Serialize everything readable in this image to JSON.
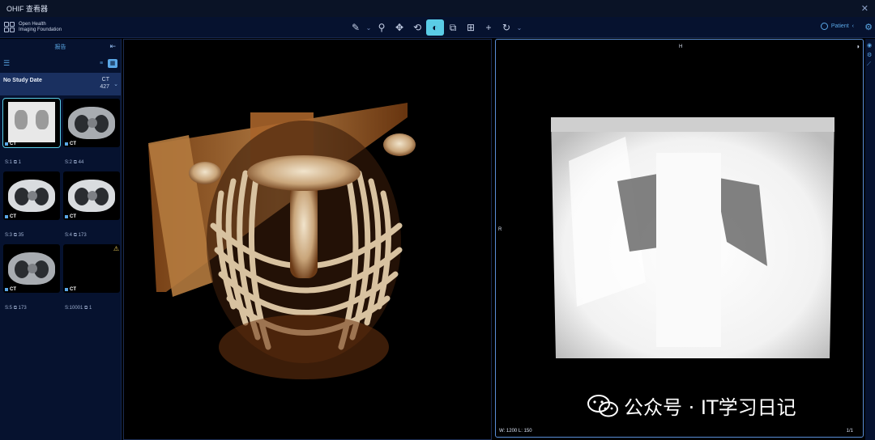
{
  "window": {
    "title": "OHIF 查看器",
    "close_icon": "close-icon"
  },
  "header": {
    "logo_line1": "Open Health",
    "logo_line2": "Imaging Foundation",
    "patient_label": "Patient",
    "tools": [
      {
        "name": "measure-icon",
        "glyph": "✎"
      },
      {
        "name": "measure-dropdown-icon",
        "glyph": "⌄",
        "small": true
      },
      {
        "name": "zoom-icon",
        "glyph": "⚲"
      },
      {
        "name": "pan-icon",
        "glyph": "✥"
      },
      {
        "name": "rotate-3d-icon",
        "glyph": "⟲"
      },
      {
        "name": "window-level-icon",
        "glyph": "◐",
        "active": true
      },
      {
        "name": "camera-icon",
        "glyph": "⧉"
      },
      {
        "name": "layout-icon",
        "glyph": "⊞"
      },
      {
        "name": "crosshair-icon",
        "glyph": "+"
      },
      {
        "name": "reset-icon",
        "glyph": "↻"
      },
      {
        "name": "more-dropdown-icon",
        "glyph": "⌄",
        "small": true
      }
    ]
  },
  "sidebar": {
    "title": "报告",
    "study": {
      "date": "No Study Date",
      "modality": "CT",
      "count": "427"
    },
    "thumbnails": [
      {
        "type": "scout",
        "modality": "CT",
        "series": "S:1",
        "count": "1",
        "selected": true
      },
      {
        "type": "axial",
        "modality": "CT",
        "series": "S:2",
        "count": "44"
      },
      {
        "type": "axial-bright",
        "modality": "CT",
        "series": "S:3",
        "count": "35"
      },
      {
        "type": "axial-bright",
        "modality": "CT",
        "series": "S:4",
        "count": "173"
      },
      {
        "type": "axial",
        "modality": "CT",
        "series": "S:5",
        "count": "173"
      },
      {
        "type": "empty",
        "modality": "CT",
        "series": "S:10001",
        "count": "1",
        "warning": true
      }
    ]
  },
  "viewport_right": {
    "top_label": "H",
    "left_label": "R",
    "window": "W:  1200  L:  150",
    "frame": "1/1"
  },
  "watermark": "公众号 · IT学习日记",
  "colors": {
    "accent": "#5acce6",
    "panel": "#06122f",
    "link": "#5aa7e6"
  }
}
